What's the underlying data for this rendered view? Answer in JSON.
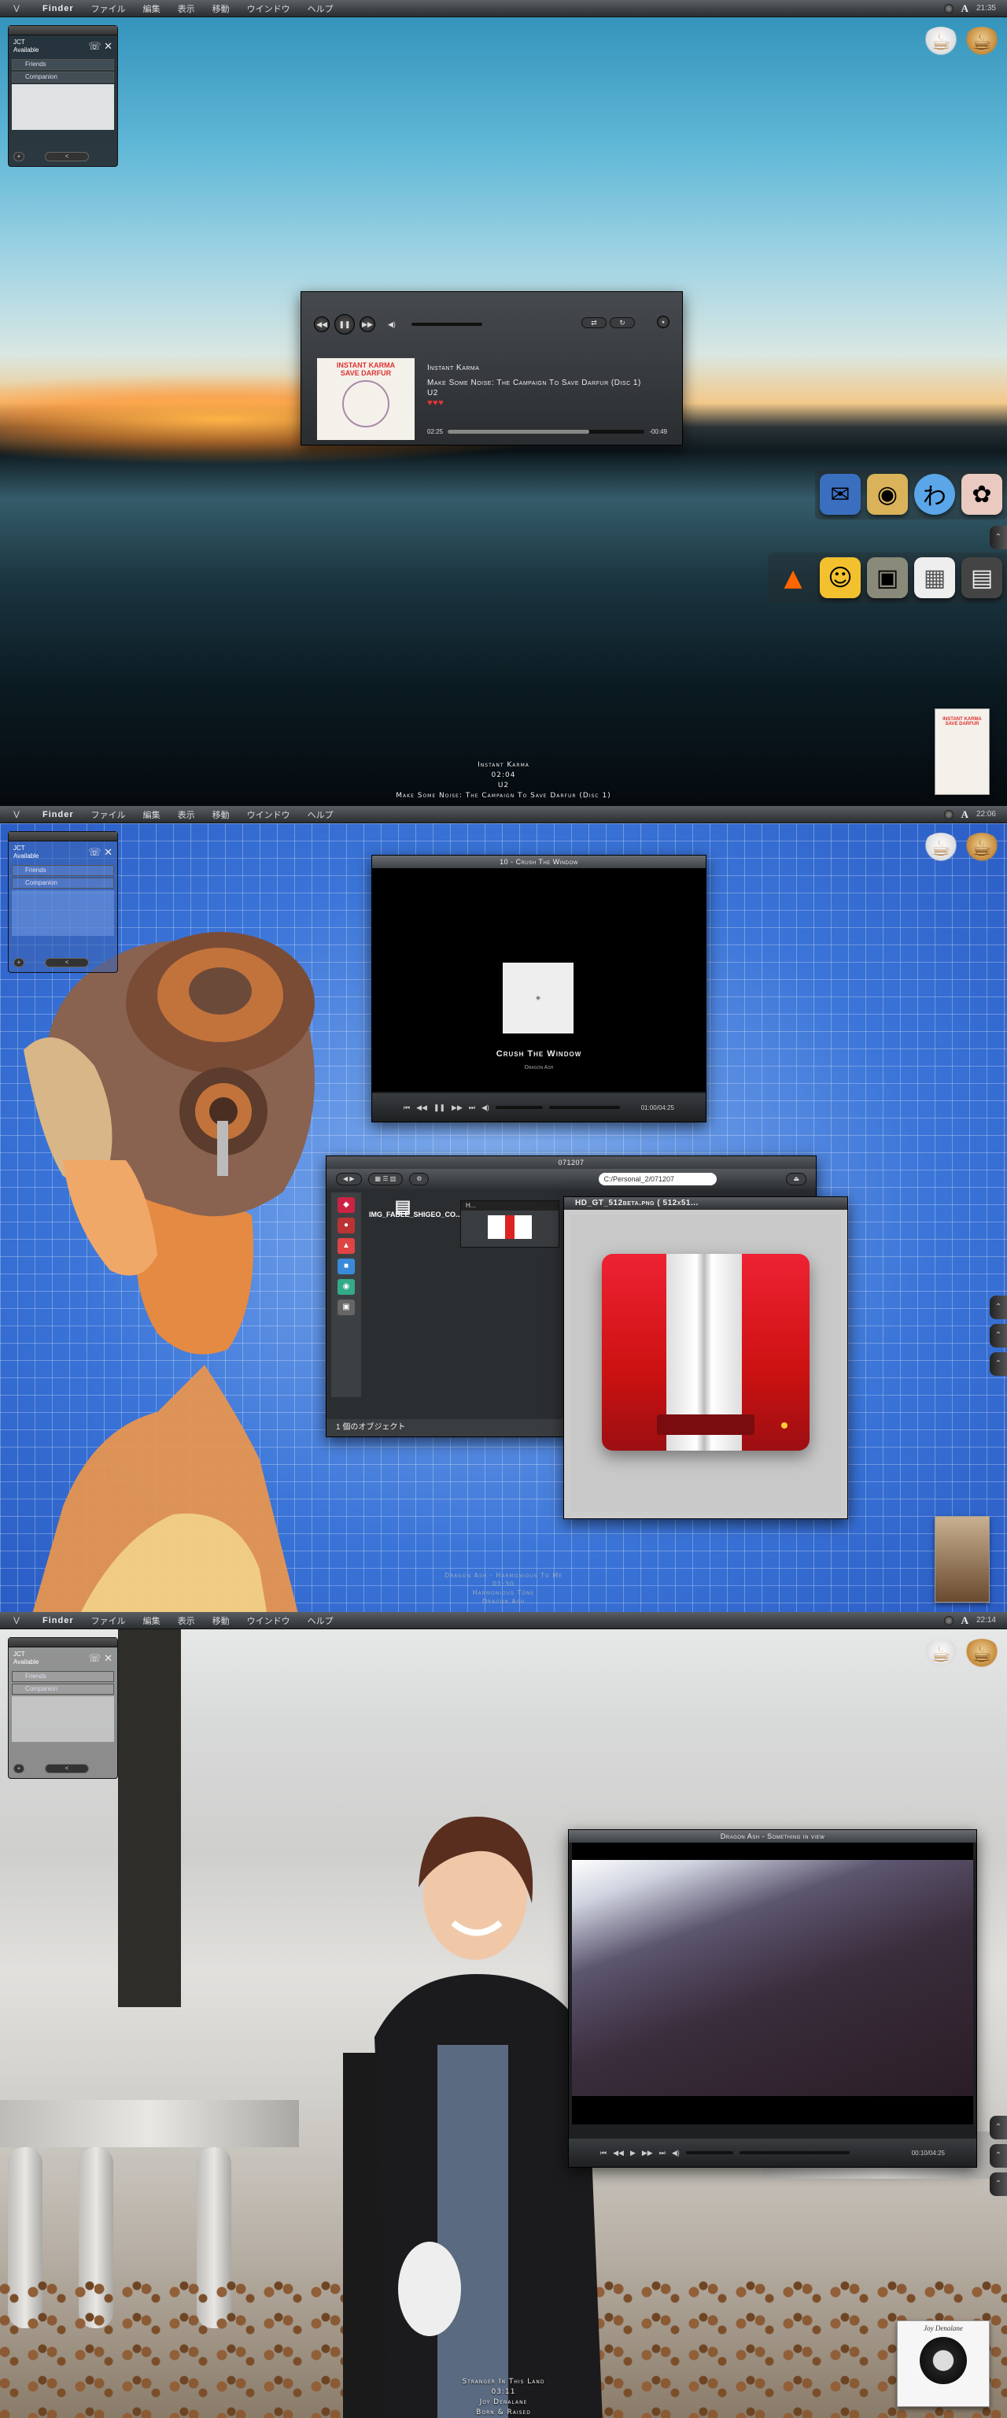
{
  "menubar": {
    "apple": "V",
    "items": [
      "Finder",
      "ファイル",
      "編集",
      "表示",
      "移動",
      "ウインドウ",
      "ヘルプ"
    ],
    "input_menu": "A",
    "clock_1": "21:35",
    "clock_2": "22:06",
    "clock_3": "22:14"
  },
  "buddy_list": {
    "name": "JCT",
    "status": "Available",
    "groups": [
      "Friends",
      "Companion"
    ],
    "footer": [
      "+",
      "<",
      "≡"
    ]
  },
  "screen1": {
    "itunes": {
      "track": "Instant Karma",
      "album": "Make Some Noise: The Campaign To Save Darfur (Disc 1)",
      "artist": "U2",
      "rating": 3,
      "rating_text": "♥♥♥",
      "elapsed": "02:25",
      "remaining": "-00:49",
      "progress": 0.72,
      "art_line1": "INSTANT KARMA",
      "art_line2": "SAVE DARFUR"
    },
    "now_playing": {
      "track": "Instant Karma",
      "time": "02:04",
      "artist": "U2",
      "album": "Make Some Noise: The Campaign To Save Darfur (Disc 1)"
    }
  },
  "screen2": {
    "video": {
      "title": "10 - Crush The Window",
      "song": "Crush The Window",
      "artist": "Dragon Ash",
      "time": "01:00/04:25"
    },
    "finder": {
      "title": "071207",
      "path": "C:/Personal_2/071207",
      "file": "IMG_FABLE_SHIGEO_CO...",
      "column_header": "H...",
      "status": "1 個のオブジェクト"
    },
    "preview": {
      "title": "HD_GT_512beta.png ( 512x51..."
    },
    "now_playing": {
      "line1": "Dragon Ash - Harmonious To Me",
      "line2": "01:30",
      "line3": "Harmonious Tone",
      "line4": "Dragon Ash"
    }
  },
  "screen3": {
    "video": {
      "title": "Dragon Ash - Something in view",
      "time": "00:10/04:25"
    },
    "now_playing": {
      "track": "Stranger In This Land",
      "time": "03:11",
      "artist": "Joy Denalane",
      "album": "Born & Raised"
    },
    "album_thumb": "Joy Denalane"
  }
}
